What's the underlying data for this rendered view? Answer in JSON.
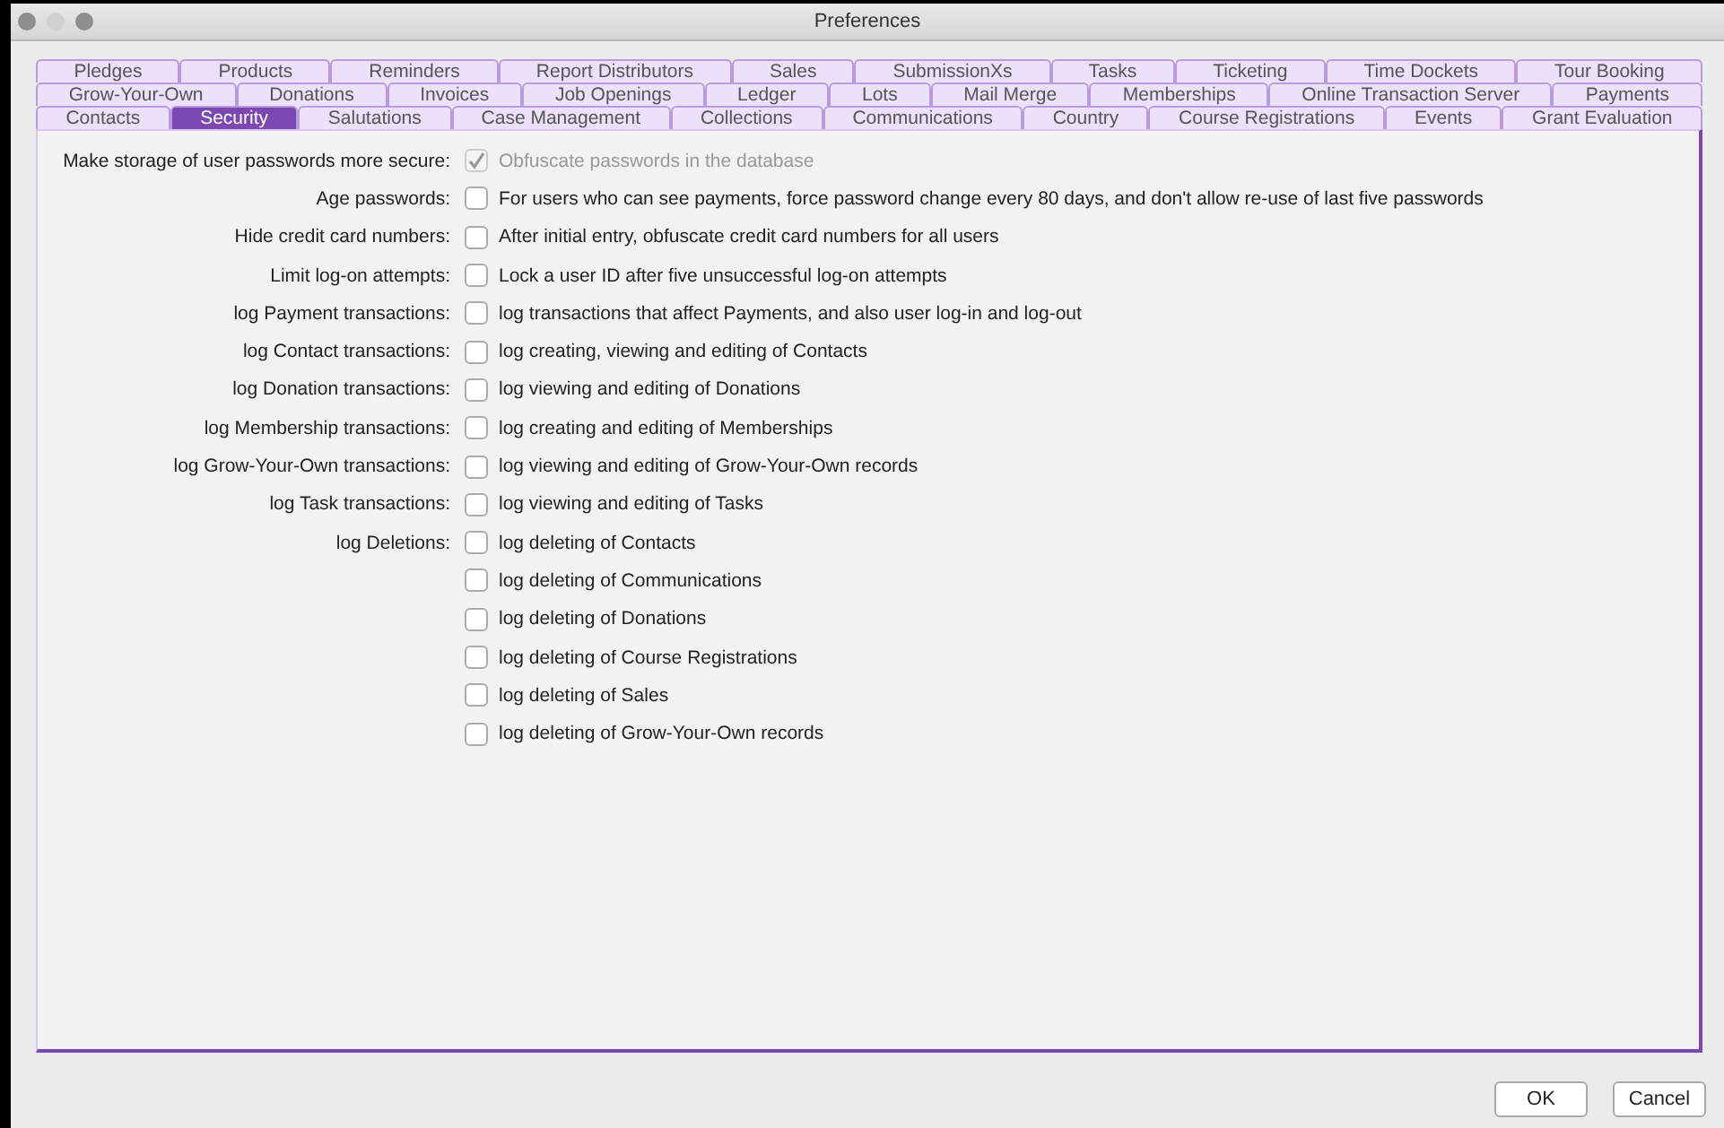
{
  "window": {
    "title": "Preferences"
  },
  "tab_rows": [
    [
      {
        "label": "Pledges",
        "selected": false
      },
      {
        "label": "Products",
        "selected": false
      },
      {
        "label": "Reminders",
        "selected": false
      },
      {
        "label": "Report Distributors",
        "selected": false
      },
      {
        "label": "Sales",
        "selected": false
      },
      {
        "label": "SubmissionXs",
        "selected": false
      },
      {
        "label": "Tasks",
        "selected": false
      },
      {
        "label": "Ticketing",
        "selected": false
      },
      {
        "label": "Time Dockets",
        "selected": false
      },
      {
        "label": "Tour Booking",
        "selected": false
      }
    ],
    [
      {
        "label": "Grow-Your-Own",
        "selected": false
      },
      {
        "label": "Donations",
        "selected": false
      },
      {
        "label": "Invoices",
        "selected": false
      },
      {
        "label": "Job Openings",
        "selected": false
      },
      {
        "label": "Ledger",
        "selected": false
      },
      {
        "label": "Lots",
        "selected": false
      },
      {
        "label": "Mail Merge",
        "selected": false
      },
      {
        "label": "Memberships",
        "selected": false
      },
      {
        "label": "Online Transaction Server",
        "selected": false
      },
      {
        "label": "Payments",
        "selected": false
      }
    ],
    [
      {
        "label": "Contacts",
        "selected": false
      },
      {
        "label": "Security",
        "selected": true
      },
      {
        "label": "Salutations",
        "selected": false
      },
      {
        "label": "Case Management",
        "selected": false
      },
      {
        "label": "Collections",
        "selected": false
      },
      {
        "label": "Communications",
        "selected": false
      },
      {
        "label": "Country",
        "selected": false
      },
      {
        "label": "Course Registrations",
        "selected": false
      },
      {
        "label": "Events",
        "selected": false
      },
      {
        "label": "Grant Evaluation",
        "selected": false
      }
    ]
  ],
  "settings": [
    {
      "label": "Make storage of user passwords more secure:",
      "option": "Obfuscate passwords in the database",
      "checked": true,
      "disabled": true
    },
    {
      "label": "Age passwords:",
      "option": "For users who can see payments, force password change every 80 days, and don't allow re-use of last five passwords",
      "checked": false,
      "disabled": false
    },
    {
      "label": "Hide credit card numbers:",
      "option": "After initial entry, obfuscate credit card numbers for all users",
      "checked": false,
      "disabled": false
    },
    {
      "label": "Limit log-on attempts:",
      "option": "Lock a user ID after five unsuccessful log-on attempts",
      "checked": false,
      "disabled": false
    },
    {
      "label": "log Payment transactions:",
      "option": "log transactions that affect Payments, and also user log-in and log-out",
      "checked": false,
      "disabled": false
    },
    {
      "label": "log Contact transactions:",
      "option": "log creating, viewing and editing of Contacts",
      "checked": false,
      "disabled": false
    },
    {
      "label": "log Donation transactions:",
      "option": "log viewing and editing of Donations",
      "checked": false,
      "disabled": false
    },
    {
      "label": "log Membership transactions:",
      "option": "log creating and editing of Memberships",
      "checked": false,
      "disabled": false
    },
    {
      "label": "log Grow-Your-Own transactions:",
      "option": "log viewing and editing of Grow-Your-Own records",
      "checked": false,
      "disabled": false
    },
    {
      "label": "log Task transactions:",
      "option": "log viewing and editing of Tasks",
      "checked": false,
      "disabled": false
    },
    {
      "label": "log Deletions:",
      "option": "log deleting of Contacts",
      "checked": false,
      "disabled": false
    },
    {
      "option": "log deleting of Communications",
      "checked": false,
      "disabled": false
    },
    {
      "option": "log deleting of Donations",
      "checked": false,
      "disabled": false
    },
    {
      "option": "log deleting of Course Registrations",
      "checked": false,
      "disabled": false
    },
    {
      "option": "log deleting of Sales",
      "checked": false,
      "disabled": false
    },
    {
      "option": "log deleting of Grow-Your-Own records",
      "checked": false,
      "disabled": false
    }
  ],
  "buttons": [
    "OK",
    "Cancel"
  ]
}
